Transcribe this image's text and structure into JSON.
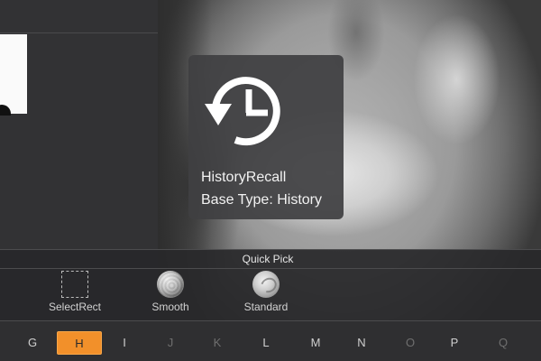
{
  "tooltip": {
    "icon": "history-recall-icon",
    "name": "HistoryRecall",
    "base_type": "Base Type: History"
  },
  "quick_pick": {
    "title": "Quick Pick",
    "tools": [
      {
        "label": "SelectRect",
        "icon": "select-rect-icon"
      },
      {
        "label": "Smooth",
        "icon": "smooth-brush-icon"
      },
      {
        "label": "Standard",
        "icon": "standard-brush-icon"
      }
    ]
  },
  "letter_bar": {
    "letters": [
      "G",
      "H",
      "I",
      "J",
      "K",
      "L",
      "M",
      "N",
      "O",
      "P",
      "Q"
    ],
    "active": "H"
  },
  "colors": {
    "accent": "#f2902a",
    "panel": "#323234",
    "tooltip_bg": "#404042"
  }
}
